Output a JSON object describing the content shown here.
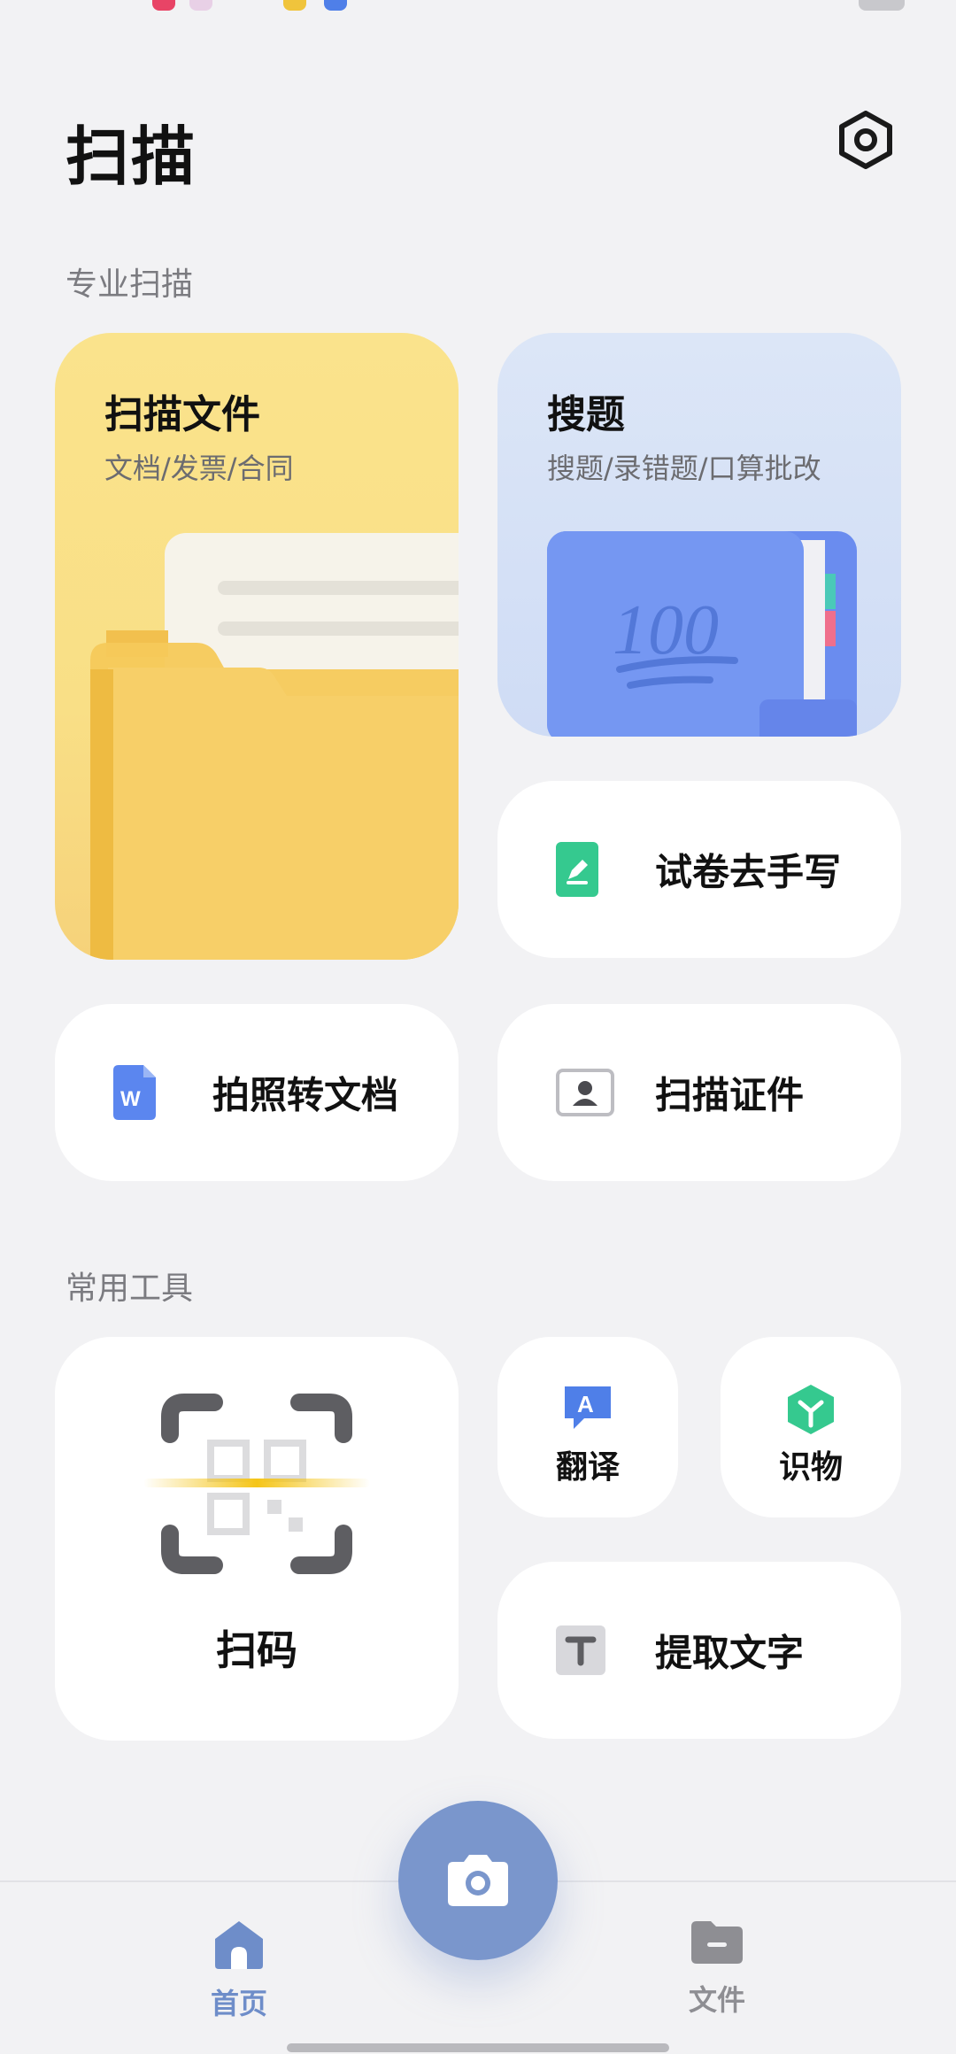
{
  "header": {
    "title": "扫描"
  },
  "sections": {
    "pro_scan_label": "专业扫描",
    "tools_label": "常用工具"
  },
  "cards": {
    "scan_file": {
      "title": "扫描文件",
      "subtitle": "文档/发票/合同"
    },
    "search_question": {
      "title": "搜题",
      "subtitle": "搜题/录错题/口算批改",
      "badge_text": "100"
    },
    "exam_remove_handwriting": {
      "label": "试卷去手写"
    },
    "photo_to_doc": {
      "label": "拍照转文档"
    },
    "scan_id": {
      "label": "扫描证件"
    }
  },
  "tools": {
    "scan_code": {
      "label": "扫码"
    },
    "translate": {
      "label": "翻译"
    },
    "identify": {
      "label": "识物"
    },
    "extract_text": {
      "label": "提取文字"
    }
  },
  "nav": {
    "home_label": "首页",
    "files_label": "文件"
  },
  "colors": {
    "accent": "#6e8dc9",
    "camera": "#7a96cc",
    "yellow_card": "#fae38c",
    "blue_card": "#d3dff5",
    "green_icon": "#35c98f",
    "word_icon": "#5b86ef"
  }
}
